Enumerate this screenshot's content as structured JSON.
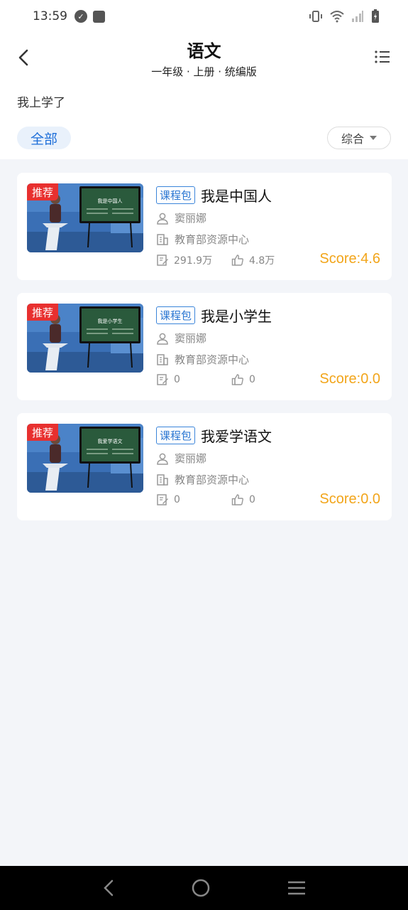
{
  "status_bar": {
    "time": "13:59"
  },
  "header": {
    "title": "语文",
    "subtitle": "一年级 · 上册 · 统编版",
    "lesson": "我上学了",
    "filter_all": "全部",
    "sort_label": "综合"
  },
  "cards": [
    {
      "badge": "推荐",
      "tag": "课程包",
      "title": "我是中国人",
      "teacher": "窦丽娜",
      "org": "教育部资源中心",
      "views": "291.9万",
      "likes": "4.8万",
      "score": "Score:4.6",
      "board_text": "我是中国人"
    },
    {
      "badge": "推荐",
      "tag": "课程包",
      "title": "我是小学生",
      "teacher": "窦丽娜",
      "org": "教育部资源中心",
      "views": "0",
      "likes": "0",
      "score": "Score:0.0",
      "board_text": "我是小学生"
    },
    {
      "badge": "推荐",
      "tag": "课程包",
      "title": "我爱学语文",
      "teacher": "窦丽娜",
      "org": "教育部资源中心",
      "views": "0",
      "likes": "0",
      "score": "Score:0.0",
      "board_text": "我爱学语文"
    }
  ],
  "colors": {
    "accent": "#1e6fd9",
    "score": "#f2a51a",
    "badge": "#e8302f",
    "background": "#f3f5f9"
  },
  "icons": [
    "back-icon",
    "list-menu-icon",
    "person-icon",
    "building-icon",
    "edit-icon",
    "thumbs-up-icon"
  ]
}
